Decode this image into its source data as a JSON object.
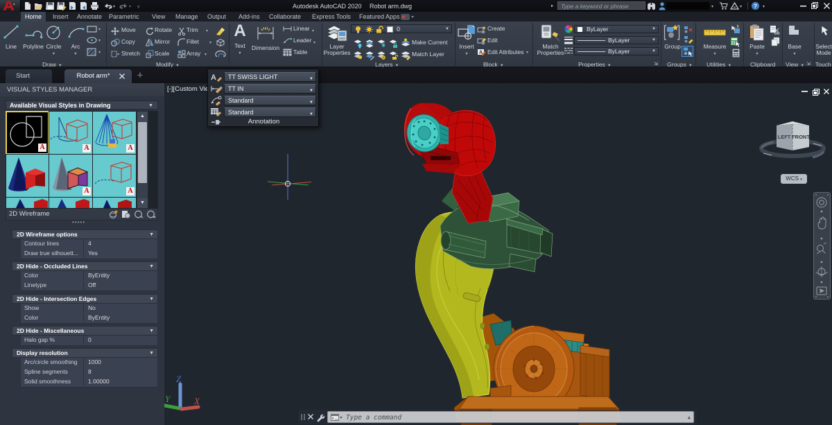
{
  "titlebar": {
    "app_title": "Autodesk AutoCAD 2020",
    "doc_title": "Robot arm.dwg",
    "search_placeholder": "Type a keyword or phrase"
  },
  "tabs": {
    "items": [
      "Home",
      "Insert",
      "Annotate",
      "Parametric",
      "View",
      "Manage",
      "Output",
      "Add-ins",
      "Collaborate",
      "Express Tools",
      "Featured Apps"
    ],
    "active": "Home"
  },
  "ribbon": {
    "draw": {
      "label": "Draw",
      "line": "Line",
      "polyline": "Polyline",
      "circle": "Circle",
      "arc": "Arc"
    },
    "modify": {
      "label": "Modify",
      "move": "Move",
      "rotate": "Rotate",
      "trim": "Trim",
      "copy": "Copy",
      "mirror": "Mirror",
      "fillet": "Fillet",
      "stretch": "Stretch",
      "scale": "Scale",
      "array": "Array"
    },
    "annotation": {
      "label": "",
      "text": "Text",
      "dimension": "Dimension",
      "linear": "Linear",
      "leader": "Leader",
      "table": "Table"
    },
    "layers": {
      "label": "Layers",
      "big": "Layer Properties",
      "layer_value": "0",
      "make_current": "Make Current",
      "match_layer": "Match Layer"
    },
    "block": {
      "label": "Block",
      "big": "Insert",
      "create": "Create",
      "edit": "Edit",
      "edit_attributes": "Edit Attributes"
    },
    "properties": {
      "label": "Properties",
      "big": "Match Properties",
      "combo1": "ByLayer",
      "combo2": "ByLayer",
      "combo3": "ByLayer"
    },
    "groups": {
      "label": "Groups",
      "big": "Group"
    },
    "utilities": {
      "label": "Utilities",
      "big": "Measure"
    },
    "clipboard": {
      "label": "Clipboard",
      "big": "Paste"
    },
    "view": {
      "label": "View",
      "big": "Base"
    },
    "touch": {
      "label": "Touch",
      "big": "Select Mode"
    }
  },
  "flyout": {
    "text_style": "TT SWISS LIGHT",
    "dim_style": "TT IN",
    "leader_style": "Standard",
    "table_style": "Standard",
    "label": "Annotation"
  },
  "filetabs": {
    "start": "Start",
    "doc": "Robot arm*"
  },
  "palette": {
    "title": "VISUAL STYLES MANAGER",
    "section": "Available Visual Styles in Drawing",
    "current_style": "2D Wireframe",
    "sections": [
      {
        "header": "2D Wireframe options",
        "rows": [
          {
            "label": "Contour lines",
            "value": "4"
          },
          {
            "label": "Draw true silhouett...",
            "value": "Yes"
          }
        ]
      },
      {
        "header": "2D Hide - Occluded Lines",
        "rows": [
          {
            "label": "Color",
            "value": "ByEntity"
          },
          {
            "label": "Linetype",
            "value": "Off"
          }
        ]
      },
      {
        "header": "2D Hide - Intersection Edges",
        "rows": [
          {
            "label": "Show",
            "value": "No"
          },
          {
            "label": "Color",
            "value": "ByEntity"
          }
        ]
      },
      {
        "header": "2D Hide - Miscellaneous",
        "rows": [
          {
            "label": "Halo gap %",
            "value": "0"
          }
        ]
      },
      {
        "header": "Display resolution",
        "rows": [
          {
            "label": "Arc/circle smoothing",
            "value": "1000"
          },
          {
            "label": "Spline segments",
            "value": "8"
          },
          {
            "label": "Solid smoothness",
            "value": "1.00000"
          }
        ]
      }
    ]
  },
  "canvas": {
    "viewport_label": "[-][Custom Vie",
    "viewcube_left": "LEFT",
    "viewcube_front": "FRONT",
    "wcs": "WCS"
  },
  "command": {
    "placeholder": "Type a command"
  },
  "icons": {
    "text_big_a": "A",
    "help_q": "?"
  },
  "colors": {
    "accent_red": "#c00a0a",
    "accent_green": "#2d5237",
    "accent_yellow": "#b6ba20",
    "accent_orange": "#b35a10",
    "accent_teal": "#43cbc3",
    "thumb_cyan": "#67cace",
    "canvas_bg": "#20262e"
  }
}
